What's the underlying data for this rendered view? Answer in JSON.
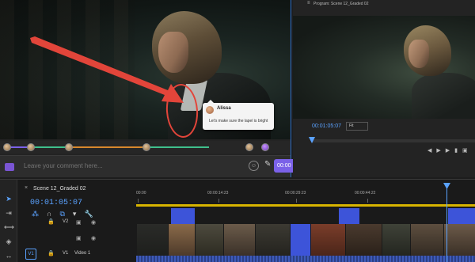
{
  "source_monitor": {
    "comment_bubble": {
      "author": "Alissa",
      "text": "Let's make sure the lapel is bright"
    },
    "comment_placeholder": "Leave your comment here...",
    "timecode": "00:00",
    "colors": {
      "accent": "#7b61e8",
      "annotation": "#e2453a",
      "panel_border": "#2f6fc9"
    }
  },
  "program_monitor": {
    "title": "Program: Scene 12_Graded 02",
    "timecode": "00:01:05:07",
    "fit_label": "Fit",
    "fit_options": [
      "Fit"
    ]
  },
  "timeline": {
    "sequence_tab": "Scene 12_Graded 02",
    "timecode": "00:01:05:07",
    "ruler_labels": [
      "00:00",
      "00:00:14:23",
      "00:00:29:23",
      "00:00:44:22"
    ],
    "tracks": [
      {
        "id": "V2",
        "label": ""
      },
      {
        "id": "V1",
        "label": "Video 1"
      }
    ],
    "colors": {
      "work_area": "#d8b400",
      "gap": "#3d54d9",
      "playhead": "#5aa2ff"
    }
  },
  "icons": [
    "selection-tool-icon",
    "track-select-icon",
    "ripple-edit-icon",
    "razor-icon",
    "slip-icon",
    "pen-icon",
    "hand-icon",
    "snap-icon",
    "linked-selection-icon",
    "add-marker-icon",
    "wrench-icon",
    "lock-icon",
    "film-icon",
    "eye-icon",
    "emoji-icon",
    "check-icon",
    "arrow-annotation-icon",
    "circle-annotation-icon"
  ]
}
